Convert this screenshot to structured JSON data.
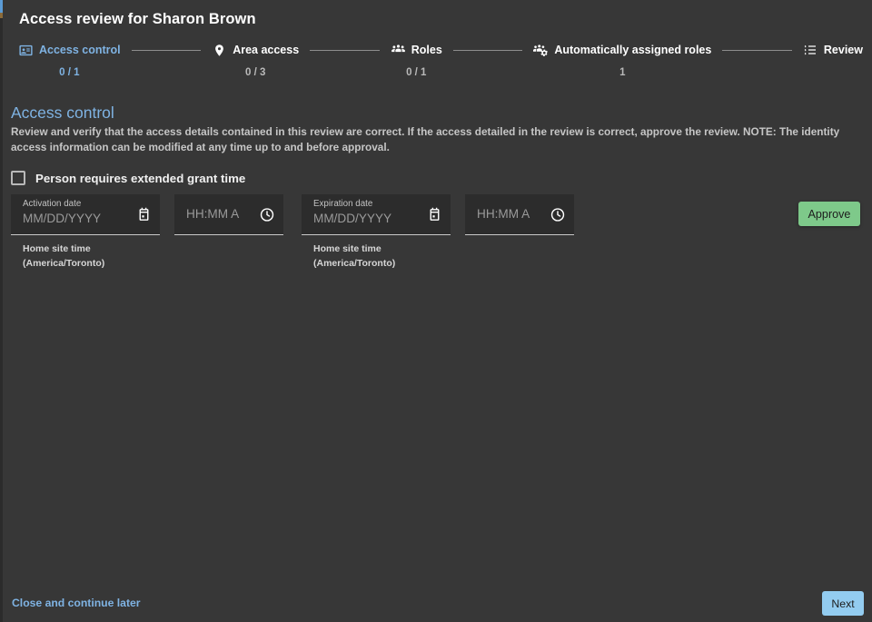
{
  "window": {
    "title": "Access review for Sharon Brown",
    "background": "#373737",
    "accent_blue": "#7fb3e3",
    "approve_green": "#7ec98a",
    "next_blue": "#93ccf0"
  },
  "stepper": {
    "steps": [
      {
        "id": "access-control",
        "label": "Access control",
        "count": "0 / 1",
        "icon": "badge-icon",
        "active": true
      },
      {
        "id": "area-access",
        "label": "Area access",
        "count": "0 / 3",
        "icon": "location-pin-icon",
        "active": false
      },
      {
        "id": "roles",
        "label": "Roles",
        "count": "0 / 1",
        "icon": "group-icon",
        "active": false
      },
      {
        "id": "automatically-assigned-roles",
        "label": "Automatically assigned roles",
        "count": "1",
        "icon": "group-settings-icon",
        "active": false
      },
      {
        "id": "review",
        "label": "Review",
        "count": "",
        "icon": "list-bulleted-icon",
        "active": false
      }
    ]
  },
  "main": {
    "section_title": "Access control",
    "description": "Review and verify that the access details contained in this review are correct. If the access detailed in the review is correct, approve the review. NOTE: The identity access information can be modified at any time up to and before approval.",
    "extended_grant": {
      "label": "Person requires extended grant time",
      "checked": false
    },
    "activation": {
      "date_label": "Activation date",
      "date_placeholder": "MM/DD/YYYY",
      "date_value": "",
      "time_placeholder": "HH:MM A",
      "time_value": "",
      "hint_line1": "Home site time",
      "hint_line2": "(America/Toronto)"
    },
    "expiration": {
      "date_label": "Expiration date",
      "date_placeholder": "MM/DD/YYYY",
      "date_value": "",
      "time_placeholder": "HH:MM A",
      "time_value": "",
      "hint_line1": "Home site time",
      "hint_line2": "(America/Toronto)"
    },
    "approve_label": "Approve"
  },
  "footer": {
    "close_label": "Close and continue later",
    "next_label": "Next"
  }
}
